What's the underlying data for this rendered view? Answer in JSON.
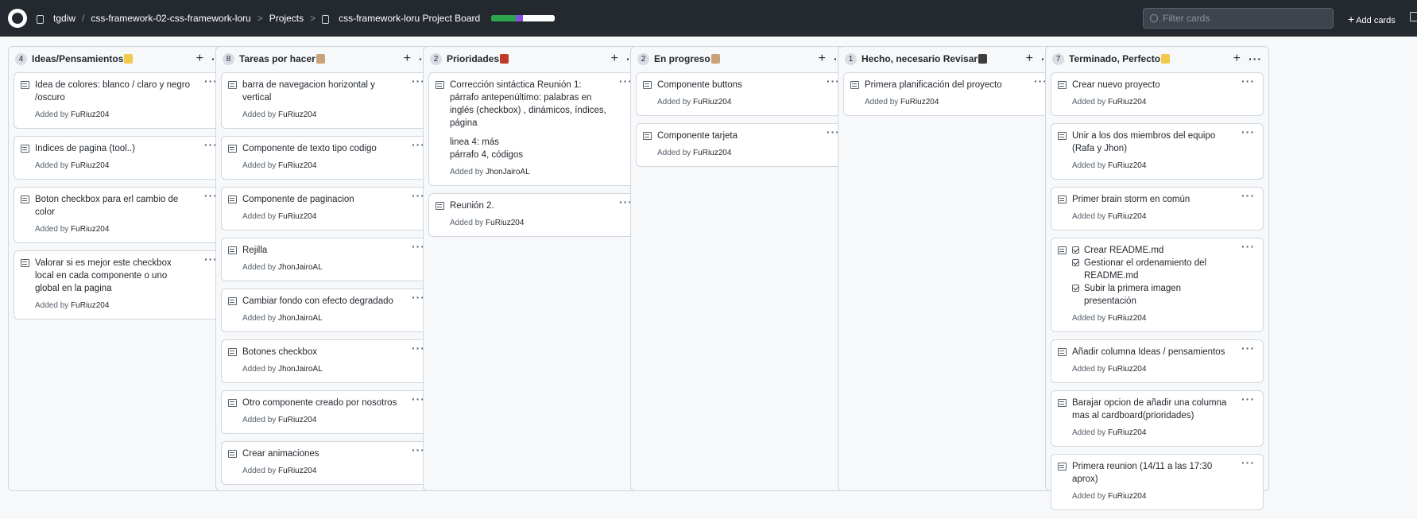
{
  "header": {
    "owner": "tgdiw",
    "repo": "css-framework-02-css-framework-loru",
    "projects": "Projects",
    "board": "css-framework-loru Project Board",
    "progress": {
      "done": 0.38,
      "in_progress": 0.12,
      "todo": 0.5
    },
    "filter_placeholder": "Filter cards",
    "add_cards": "Add cards"
  },
  "columns": [
    {
      "count": "4",
      "title": "Ideas/Pensamientos",
      "emoji": "lightbulb-icon",
      "emoji_color": "#f2c94c",
      "cards": [
        {
          "text": "Idea de colores: blanco / claro y negro /oscuro",
          "added": "Added by",
          "who": "FuRiuz204"
        },
        {
          "text": "Indices de pagina (tool..)",
          "added": "Added by",
          "who": "FuRiuz204"
        },
        {
          "text": "Boton checkbox para erl cambio de color",
          "added": "Added by",
          "who": "FuRiuz204"
        },
        {
          "text": "Valorar si es mejor este checkbox local en cada componente o uno global en la pagina",
          "added": "Added by",
          "who": "FuRiuz204"
        }
      ]
    },
    {
      "count": "8",
      "title": "Tareas por hacer",
      "emoji": "memo-icon",
      "emoji_color": "#c9a27b",
      "cards": [
        {
          "text": "barra de navegacion horizontal y vertical",
          "added": "Added by",
          "who": "FuRiuz204"
        },
        {
          "text": "Componente de texto tipo codigo",
          "added": "Added by",
          "who": "FuRiuz204"
        },
        {
          "text": "Componente de paginacion",
          "added": "Added by",
          "who": "FuRiuz204"
        },
        {
          "text": "Rejilla",
          "added": "Added by",
          "who": "JhonJairoAL"
        },
        {
          "text": "Cambiar fondo con efecto degradado",
          "added": "Added by",
          "who": "JhonJairoAL"
        },
        {
          "text": "Botones checkbox",
          "added": "Added by",
          "who": "JhonJairoAL"
        },
        {
          "text": "Otro componente creado por nosotros",
          "added": "Added by",
          "who": "FuRiuz204"
        },
        {
          "text": "Crear animaciones",
          "added": "Added by",
          "who": "FuRiuz204"
        }
      ]
    },
    {
      "count": "2",
      "title": "Prioridades",
      "emoji": "exclamation-icon",
      "emoji_color": "#c0392b",
      "cards": [
        {
          "text": "Corrección sintáctica Reunión 1: párrafo antepenúltimo: palabras en inglés (checkbox) , dinámicos, índices, página",
          "para": [
            "linea 4: más",
            "párrafo 4, códigos"
          ],
          "added": "Added by",
          "who": "JhonJairoAL"
        },
        {
          "text": "Reunión 2.",
          "added": "Added by",
          "who": "FuRiuz204"
        }
      ]
    },
    {
      "count": "2",
      "title": "En progreso",
      "emoji": "memo-icon",
      "emoji_color": "#c9a27b",
      "cards": [
        {
          "text": "Componente buttons",
          "added": "Added by",
          "who": "FuRiuz204"
        },
        {
          "text": "Componente tarjeta",
          "added": "Added by",
          "who": "FuRiuz204"
        }
      ]
    },
    {
      "count": "1",
      "title": "Hecho, necesario Revisar",
      "emoji": "eyes-icon",
      "emoji_color": "#3d3d3d",
      "cards": [
        {
          "text": "Primera planificación del proyecto",
          "added": "Added by",
          "who": "FuRiuz204"
        }
      ]
    },
    {
      "count": "7",
      "title": "Terminado, Perfecto",
      "emoji": "ok-hand-icon",
      "emoji_color": "#f2c94c",
      "cards": [
        {
          "text": "Crear nuevo proyecto",
          "added": "Added by",
          "who": "FuRiuz204"
        },
        {
          "text": "Unir a los dos miembros del equipo (Rafa y Jhon)",
          "added": "Added by",
          "who": "FuRiuz204"
        },
        {
          "text": "Primer brain storm en común",
          "added": "Added by",
          "who": "FuRiuz204"
        },
        {
          "checks": [
            "Crear README.md",
            "Gestionar el ordenamiento del README.md",
            "Subir la primera imagen presentación"
          ],
          "added": "Added by",
          "who": "FuRiuz204"
        },
        {
          "text": "Añadir columna Ideas / pensamientos",
          "added": "Added by",
          "who": "FuRiuz204"
        },
        {
          "text": "Barajar opcion de añadir una columna mas al cardboard(prioridades)",
          "added": "Added by",
          "who": "FuRiuz204"
        },
        {
          "text": "Primera reunion (14/11 a las 17:30 aprox)",
          "added": "Added by",
          "who": "FuRiuz204"
        }
      ]
    }
  ]
}
